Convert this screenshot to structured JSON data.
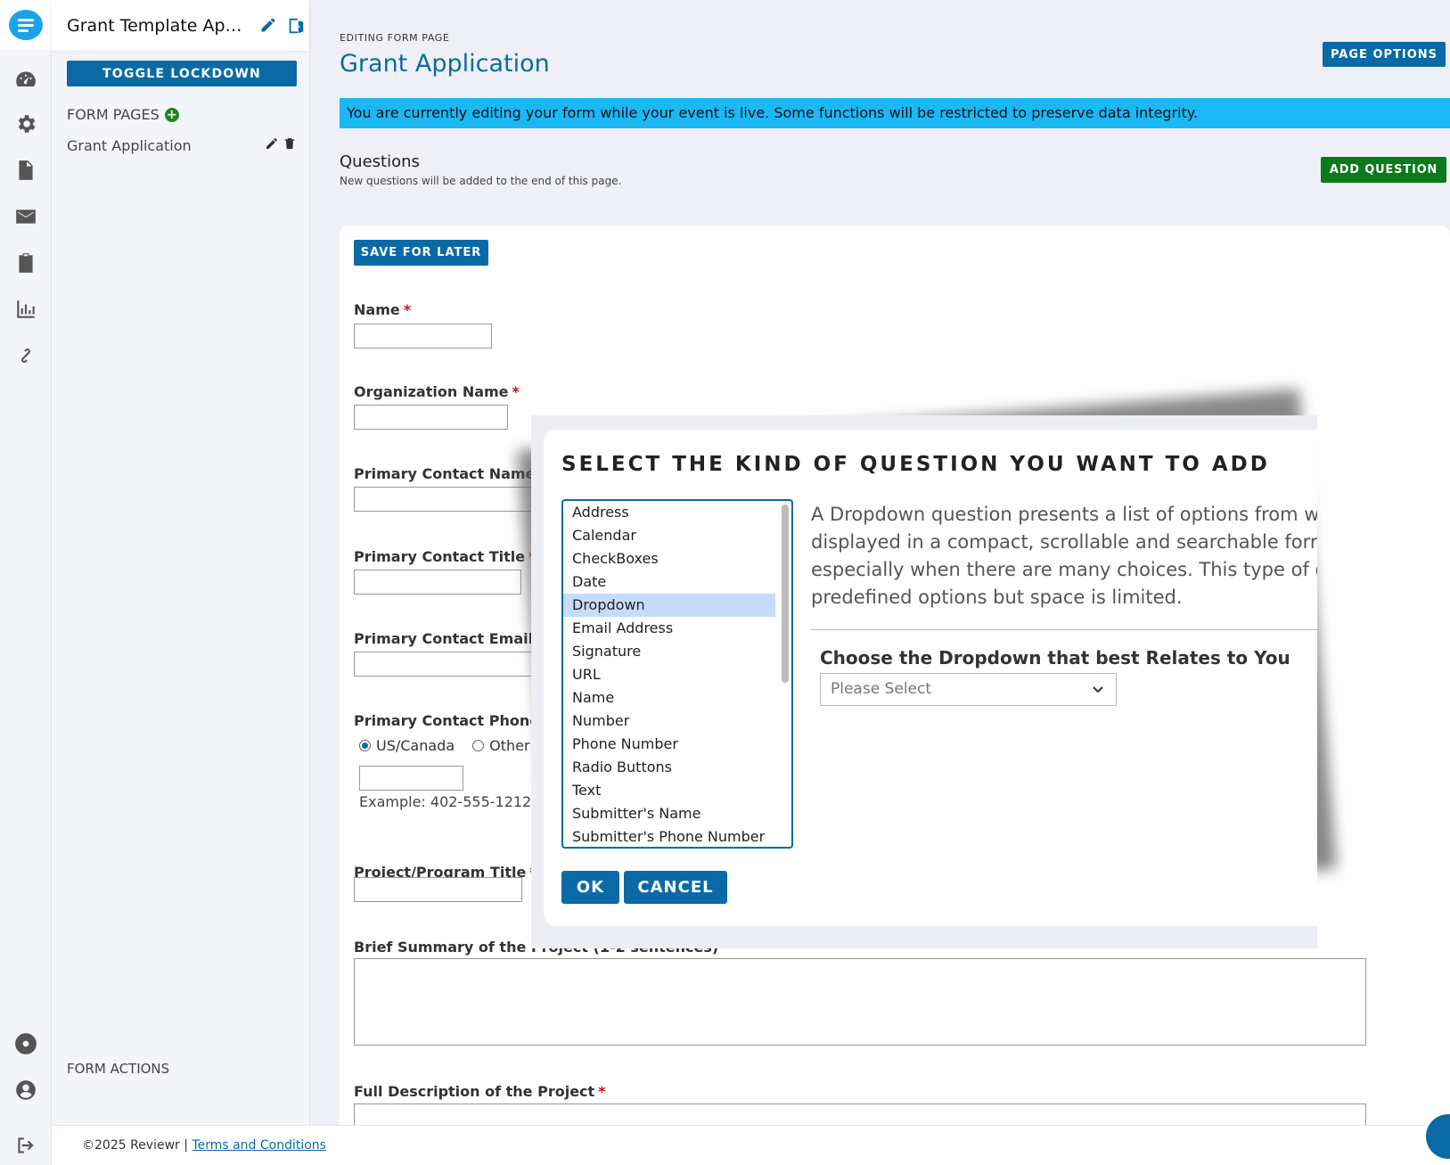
{
  "sidebar": {
    "form_title": "Grant Template Appli...",
    "toggle_lockdown": "TOGGLE LOCKDOWN",
    "form_pages_label": "FORM PAGES",
    "add_icon_glyph": "+",
    "pages": [
      {
        "label": "Grant Application"
      }
    ],
    "form_actions_label": "FORM ACTIONS"
  },
  "header": {
    "editing_label": "EDITING FORM PAGE",
    "page_title": "Grant Application",
    "page_options": "PAGE OPTIONS"
  },
  "banner": {
    "text": "You are currently editing your form while your event is live. Some functions will be restricted to preserve data integrity."
  },
  "questions": {
    "title": "Questions",
    "subtitle": "New questions will be added to the end of this page.",
    "add_button": "ADD QUESTION"
  },
  "form": {
    "save_for_later": "SAVE FOR LATER",
    "required_mark": "*",
    "fields": [
      {
        "label": "Name"
      },
      {
        "label": "Organization Name"
      },
      {
        "label": "Primary Contact Name"
      },
      {
        "label": "Primary Contact Title"
      },
      {
        "label": "Primary Contact Email"
      },
      {
        "label": "Primary Contact Phone N"
      },
      {
        "label": "Project/Program Title"
      },
      {
        "label": "Brief Summary of the Project (1-2 sentences)"
      },
      {
        "label": "Full Description of the Project"
      }
    ],
    "phone_options": [
      "US/Canada",
      "Other"
    ],
    "phone_example": "Example: 402-555-1212"
  },
  "modal": {
    "title": "SELECT THE KIND OF QUESTION YOU WANT TO ADD",
    "options": [
      "Address",
      "Calendar",
      "CheckBoxes",
      "Date",
      "Dropdown",
      "Email Address",
      "Signature",
      "URL",
      "Name",
      "Number",
      "Phone Number",
      "Radio Buttons",
      "Text",
      "Submitter's Name",
      "Submitter's Phone Number"
    ],
    "selected": "Dropdown",
    "description_lines": [
      "A Dropdown question presents a list of options from wh",
      "displayed in a compact, scrollable and searchable forr",
      "especially when there are many choices. This type of q",
      "predefined options but space is limited."
    ],
    "preview_label": "Choose the Dropdown that best Relates to You",
    "preview_placeholder": "Please Select",
    "ok": "OK",
    "cancel": "CANCEL"
  },
  "footer": {
    "copyright": "©2025 Reviewr | ",
    "terms": "Terms and Conditions"
  },
  "colors": {
    "primary": "#0a6aa6",
    "banner": "#1ab8f5",
    "add_green": "#0a7a1a",
    "required_red": "#d01010",
    "selection": "#c5dcfb"
  }
}
